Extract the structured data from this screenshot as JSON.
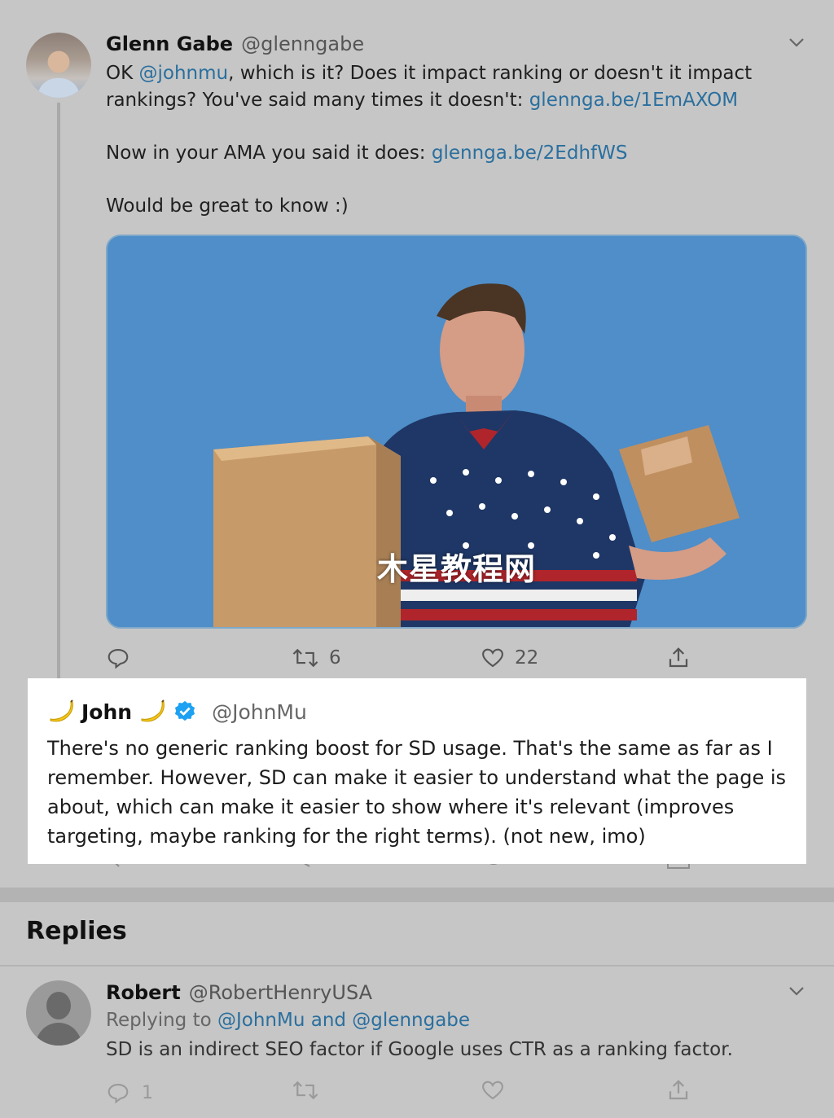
{
  "main_tweet": {
    "name": "Glenn Gabe",
    "handle": "@glenngabe",
    "line1_prefix": "OK ",
    "mention": "@johnmu",
    "line1_rest": ", which is it? Does it impact ranking or doesn't it impact rankings? You've said many times it doesn't: ",
    "link1": "glennga.be/1EmAXOM",
    "line2_prefix": "Now in your AMA you said it does: ",
    "link2": "glennga.be/2EdhfWS",
    "line3": "Would be great to know :)",
    "retweets": "6",
    "likes": "22",
    "watermark": "木星教程网"
  },
  "quote": {
    "name": "John",
    "handle": "@JohnMu",
    "text": "There's no generic ranking boost for SD usage. That's the same as far as I remember. However, SD can make it easier to understand what the page is about, which can make it easier to show where it's relevant (improves targeting, maybe ranking for the right terms). (not new, imo)"
  },
  "replies": {
    "title": "Replies",
    "items": [
      {
        "name": "Robert",
        "handle": "@RobertHenryUSA",
        "replying_prefix": "Replying to ",
        "replying_targets": "@JohnMu and @glenngabe",
        "text": "SD is an indirect SEO factor if Google uses CTR as a ranking factor.",
        "reply_count": "1"
      }
    ]
  },
  "colors": {
    "link": "#2a6f9e",
    "verified": "#1da1f2",
    "media_bg": "#4f8ec8"
  }
}
